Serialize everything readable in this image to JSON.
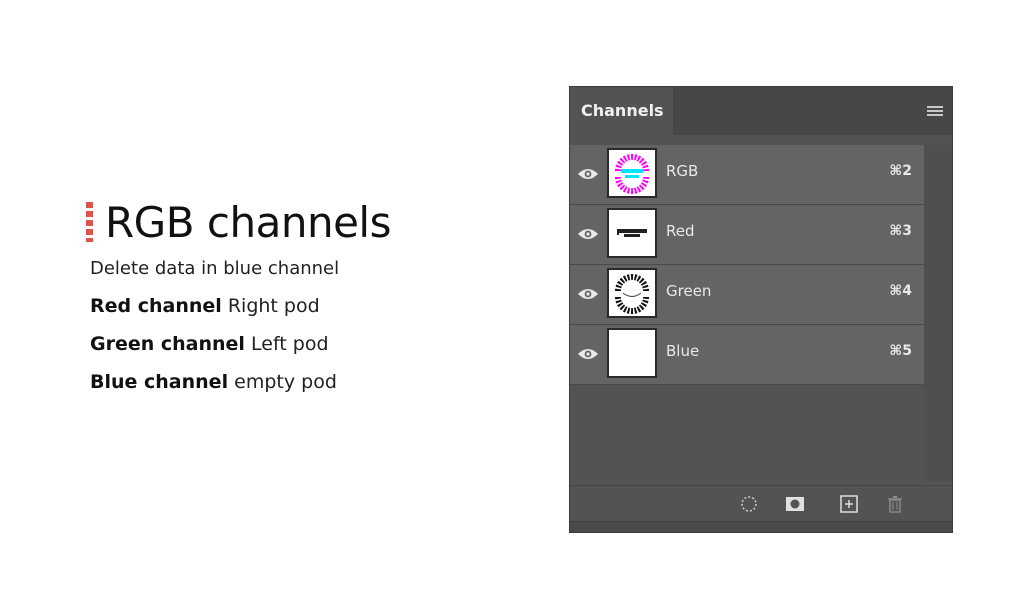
{
  "slide": {
    "title": "RGB channels",
    "subtitle": "Delete data in blue channel",
    "lines": [
      {
        "strong": "Red channel",
        "rest": "Right pod"
      },
      {
        "strong": "Green channel",
        "rest": "Left pod"
      },
      {
        "strong": "Blue channel",
        "rest": "empty pod"
      }
    ],
    "accent_color": "#d9534f"
  },
  "panel": {
    "tab_label": "Channels",
    "menu_icon": "panel-menu-icon",
    "channels": [
      {
        "name": "RGB",
        "shortcut": "⌘2",
        "thumb": "rgb"
      },
      {
        "name": "Red",
        "shortcut": "⌘3",
        "thumb": "red"
      },
      {
        "name": "Green",
        "shortcut": "⌘4",
        "thumb": "green"
      },
      {
        "name": "Blue",
        "shortcut": "⌘5",
        "thumb": "blue"
      }
    ],
    "footer_icons": [
      "load-selection-icon",
      "save-selection-icon",
      "new-channel-icon",
      "delete-channel-icon"
    ],
    "colors": {
      "panel_bg": "#535353",
      "row_bg": "#646464",
      "text": "#e8e8e8",
      "thumb_magenta": "#ff00ff",
      "thumb_cyan": "#00e5ff"
    }
  }
}
